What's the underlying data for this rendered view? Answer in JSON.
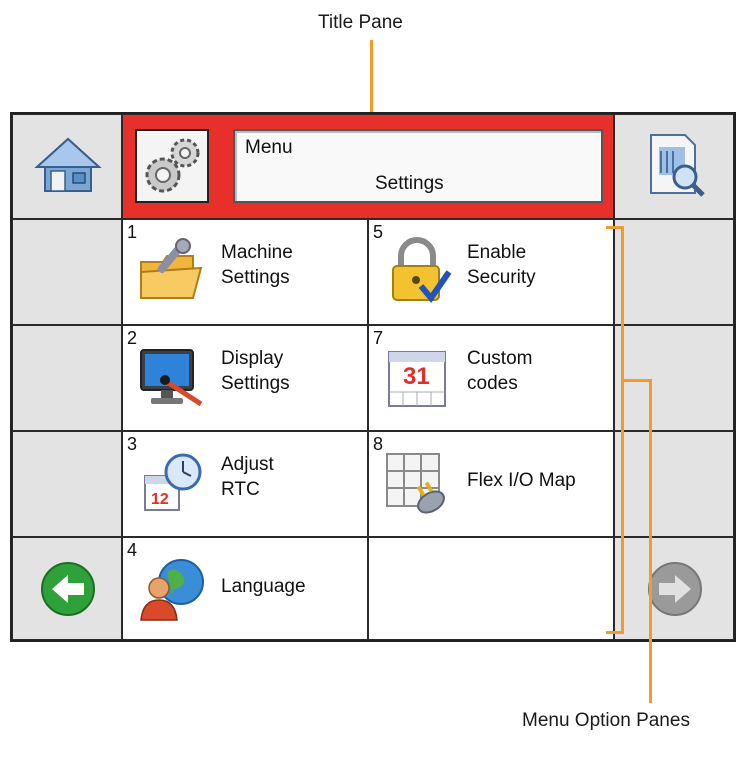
{
  "annotations": {
    "title_pane": "Title Pane",
    "menu_option_panes": "Menu Option Panes"
  },
  "colors": {
    "title_bar": "#e8302a",
    "callout_line": "#f39a2b",
    "arrow_active": "#2fa13a",
    "arrow_inactive": "#9a9a9a"
  },
  "title": {
    "line1": "Menu",
    "line2": "Settings"
  },
  "nav": {
    "home_icon": "home-icon",
    "preview_icon": "document-magnifier-icon",
    "back_icon": "arrow-left-icon",
    "forward_icon": "arrow-right-icon"
  },
  "options": [
    {
      "num": "1",
      "label": "Machine\nSettings",
      "icon": "wrench-folder-icon"
    },
    {
      "num": "5",
      "label": "Enable\nSecurity",
      "icon": "padlock-icon"
    },
    {
      "num": "2",
      "label": "Display\nSettings",
      "icon": "monitor-icon"
    },
    {
      "num": "7",
      "label": "Custom\ncodes",
      "icon": "calendar-icon"
    },
    {
      "num": "3",
      "label": "Adjust\nRTC",
      "icon": "clock-calendar-icon"
    },
    {
      "num": "8",
      "label": "Flex I/O Map",
      "icon": "grid-plug-icon"
    },
    {
      "num": "4",
      "label": "Language",
      "icon": "globe-person-icon"
    }
  ]
}
